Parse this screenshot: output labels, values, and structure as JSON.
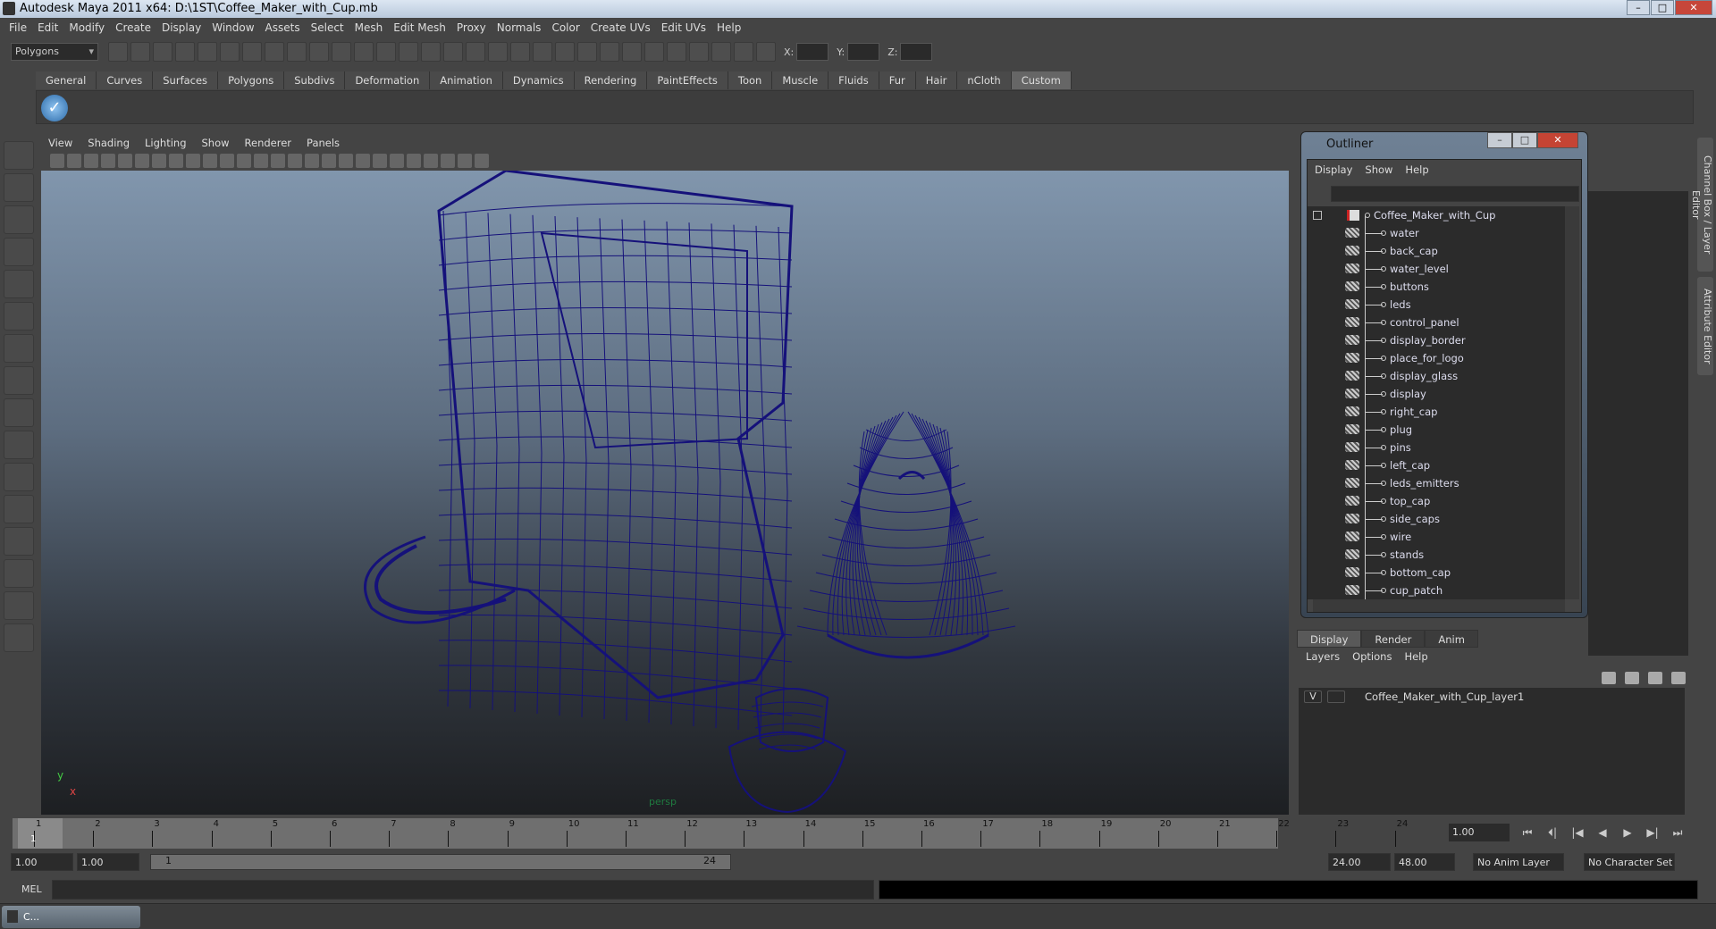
{
  "window": {
    "title": "Autodesk Maya 2011 x64: D:\\1ST\\Coffee_Maker_with_Cup.mb",
    "min": "–",
    "max": "□",
    "close": "✕"
  },
  "menubar": [
    "File",
    "Edit",
    "Modify",
    "Create",
    "Display",
    "Window",
    "Assets",
    "Select",
    "Mesh",
    "Edit Mesh",
    "Proxy",
    "Normals",
    "Color",
    "Create UVs",
    "Edit UVs",
    "Help"
  ],
  "toolbar": {
    "mode": "Polygons",
    "x_label": "X:",
    "y_label": "Y:",
    "z_label": "Z:",
    "x_value": "",
    "y_value": "",
    "z_value": ""
  },
  "shelf": {
    "tabs": [
      "General",
      "Curves",
      "Surfaces",
      "Polygons",
      "Subdivs",
      "Deformation",
      "Animation",
      "Dynamics",
      "Rendering",
      "PaintEffects",
      "Toon",
      "Muscle",
      "Fluids",
      "Fur",
      "Hair",
      "nCloth",
      "Custom"
    ],
    "active": "Custom",
    "item_icon": "checkmark-icon"
  },
  "viewport": {
    "menu": [
      "View",
      "Shading",
      "Lighting",
      "Show",
      "Renderer",
      "Panels"
    ],
    "camera": "persp",
    "axis_x": "x",
    "axis_y": "y",
    "wire_color": "#15117a"
  },
  "outliner": {
    "title": "Outliner",
    "menu": [
      "Display",
      "Show",
      "Help"
    ],
    "filter": "",
    "root": "Coffee_Maker_with_Cup",
    "items": [
      "water",
      "back_cap",
      "water_level",
      "buttons",
      "leds",
      "control_panel",
      "display_border",
      "place_for_logo",
      "display_glass",
      "display",
      "right_cap",
      "plug",
      "pins",
      "left_cap",
      "leds_emitters",
      "top_cap",
      "side_caps",
      "wire",
      "stands",
      "bottom_cap",
      "cup_patch"
    ]
  },
  "side_tabs": {
    "channel_box": "Channel Box / Layer Editor",
    "attribute_editor": "Attribute Editor"
  },
  "layers": {
    "tabs": [
      "Display",
      "Render",
      "Anim"
    ],
    "active": "Display",
    "menu": [
      "Layers",
      "Options",
      "Help"
    ],
    "rows": [
      {
        "visible": "V",
        "name": "Coffee_Maker_with_Cup_layer1"
      }
    ]
  },
  "timeline": {
    "frames": [
      "1",
      "2",
      "3",
      "4",
      "5",
      "6",
      "7",
      "8",
      "9",
      "10",
      "11",
      "12",
      "13",
      "14",
      "15",
      "16",
      "17",
      "18",
      "19",
      "20",
      "21",
      "22",
      "23",
      "24"
    ],
    "current_frame_label": "1",
    "current_time": "1.00"
  },
  "playback": {
    "buttons": [
      "⏮",
      "⏴|",
      "|◀",
      "◀",
      "▶",
      "▶|",
      "⏭"
    ]
  },
  "range": {
    "start_time": "1.00",
    "playback_start": "1.00",
    "slider_start": "1",
    "slider_end": "24",
    "playback_end": "24.00",
    "end_time": "48.00",
    "anim_layer": "No Anim Layer",
    "character_set": "No Character Set"
  },
  "command": {
    "label": "MEL",
    "input": "",
    "result": ""
  },
  "taskbar": {
    "label": "C..."
  }
}
